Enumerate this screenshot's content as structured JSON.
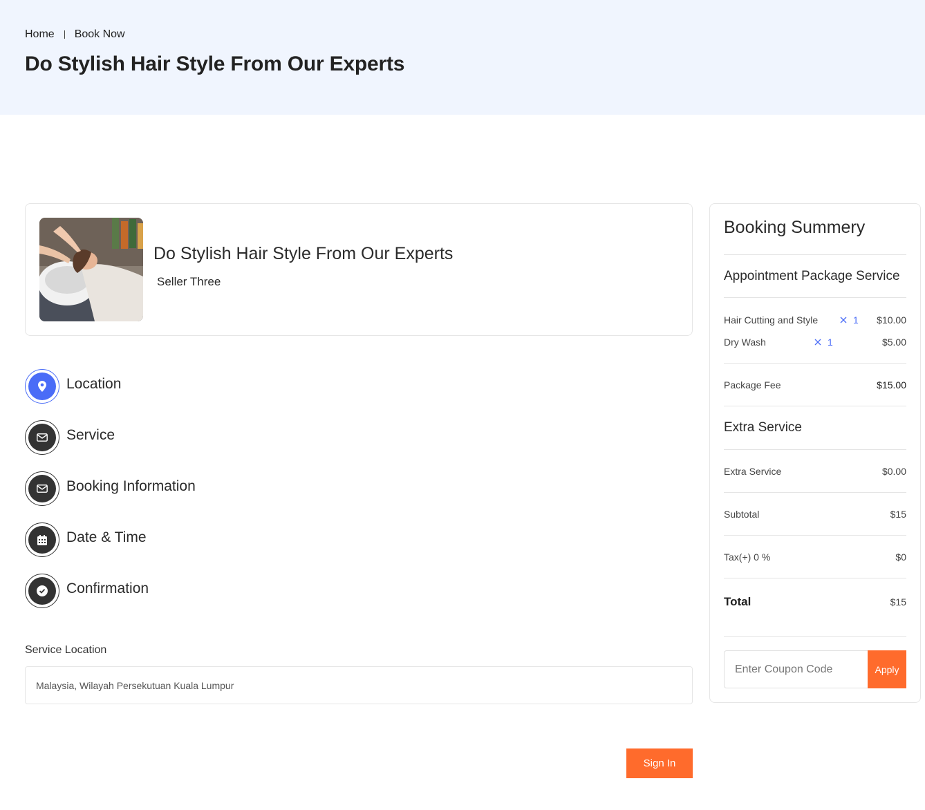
{
  "breadcrumb": {
    "home": "Home",
    "current": "Book Now"
  },
  "page_title": "Do Stylish Hair Style From Our Experts",
  "service": {
    "title": "Do Stylish Hair Style From Our Experts",
    "seller": "Seller Three"
  },
  "steps": [
    {
      "label": "Location",
      "icon": "location-pin-icon",
      "active": true
    },
    {
      "label": "Service",
      "icon": "envelope-icon",
      "active": false
    },
    {
      "label": "Booking Information",
      "icon": "envelope-icon",
      "active": false
    },
    {
      "label": "Date & Time",
      "icon": "calendar-icon",
      "active": false
    },
    {
      "label": "Confirmation",
      "icon": "check-circle-icon",
      "active": false
    }
  ],
  "location": {
    "label": "Service Location",
    "value": "Malaysia, Wilayah Persekutuan Kuala Lumpur"
  },
  "signin_label": "Sign In",
  "summary": {
    "title": "Booking Summery",
    "package_title": "Appointment Package Service",
    "items": [
      {
        "name": "Hair Cutting and Style",
        "qty": "1",
        "price": "$10.00"
      },
      {
        "name": "Dry Wash",
        "qty": "1",
        "price": "$5.00"
      }
    ],
    "package_fee_label": "Package Fee",
    "package_fee_value": "$15.00",
    "extra_title": "Extra Service",
    "extra_label": "Extra Service",
    "extra_value": "$0.00",
    "subtotal_label": "Subtotal",
    "subtotal_value": "$15",
    "tax_label": "Tax(+) 0 %",
    "tax_value": "$0",
    "total_label": "Total",
    "total_value": "$15",
    "coupon_placeholder": "Enter Coupon Code",
    "apply_label": "Apply"
  },
  "colors": {
    "accent": "#ff6b2c",
    "primary": "#4a6cf7",
    "hero_bg": "#f0f5fe"
  }
}
